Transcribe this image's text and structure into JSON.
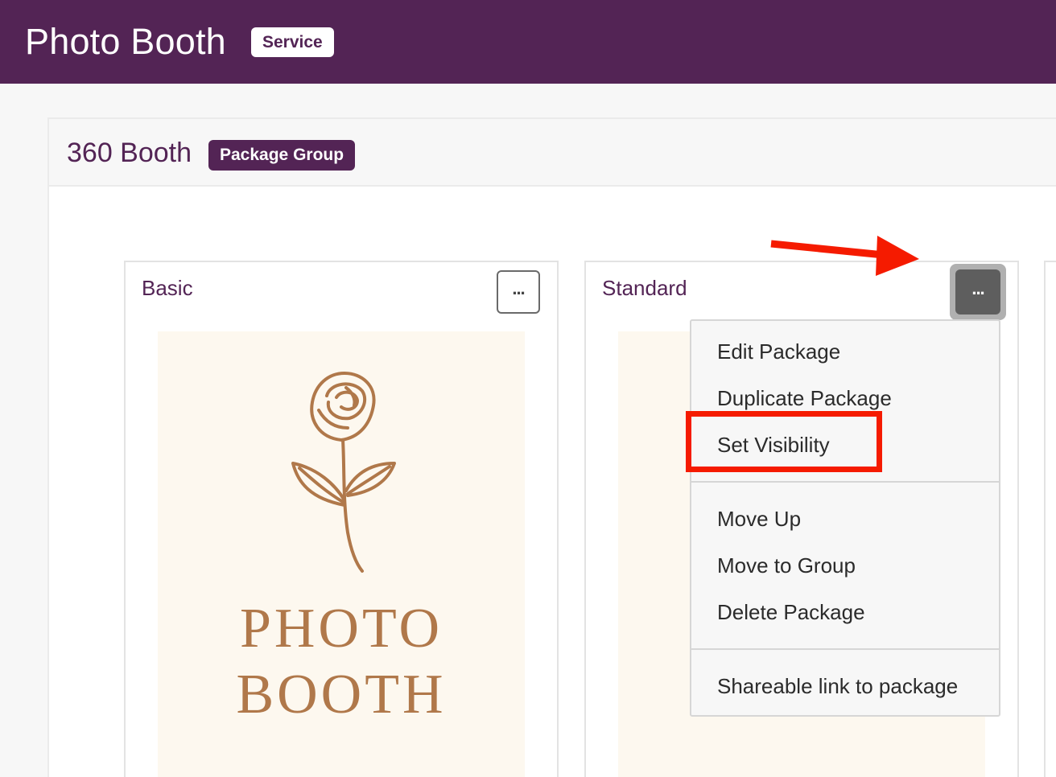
{
  "header": {
    "title": "Photo Booth",
    "badge": "Service"
  },
  "group": {
    "title": "360 Booth",
    "badge": "Package Group"
  },
  "cards": [
    {
      "title": "Basic",
      "image_text_line1": "PHOTO",
      "image_text_line2": "BOOTH"
    },
    {
      "title": "Standard"
    }
  ],
  "menu": {
    "section1": [
      "Edit Package",
      "Duplicate Package",
      "Set Visibility"
    ],
    "section2": [
      "Move Up",
      "Move to Group",
      "Delete Package"
    ],
    "section3": [
      "Shareable link to package"
    ]
  },
  "icons": {
    "more": "more-options-icon",
    "rose": "rose-icon",
    "arrow": "arrow-icon"
  },
  "colors": {
    "brand": "#532455",
    "highlight": "#f51b00",
    "image_text": "#b0784a"
  }
}
